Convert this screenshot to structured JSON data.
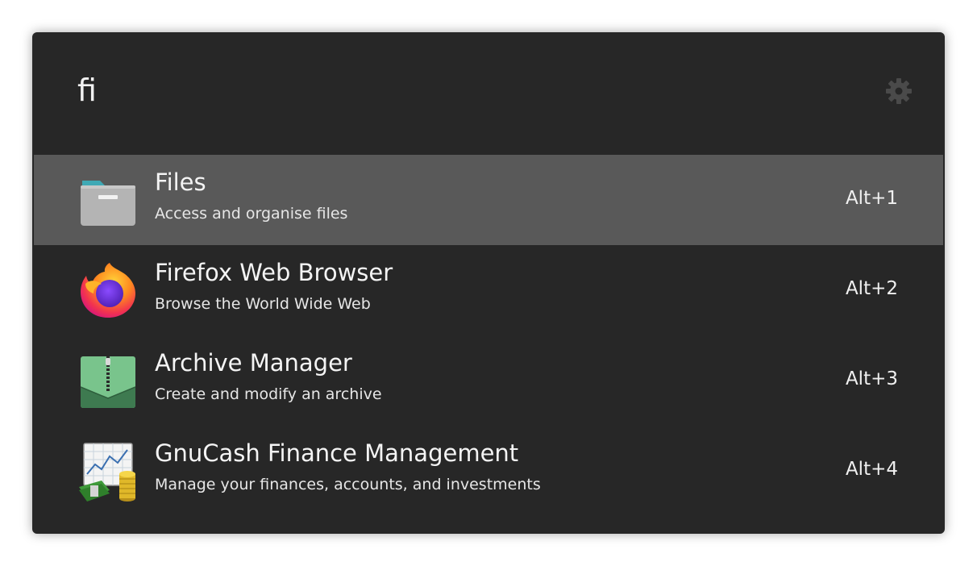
{
  "search": {
    "value": "fi"
  },
  "settings": {
    "icon": "gear-icon"
  },
  "colors": {
    "window_bg": "#272727",
    "selected_bg": "#595959",
    "text": "#f4f4f4"
  },
  "results": [
    {
      "title": "Files",
      "description": "Access and organise files",
      "shortcut": "Alt+1",
      "icon": "folder-icon",
      "selected": true
    },
    {
      "title": "Firefox Web Browser",
      "description": "Browse the World Wide Web",
      "shortcut": "Alt+2",
      "icon": "firefox-icon",
      "selected": false
    },
    {
      "title": "Archive Manager",
      "description": "Create and modify an archive",
      "shortcut": "Alt+3",
      "icon": "archive-icon",
      "selected": false
    },
    {
      "title": "GnuCash Finance Management",
      "description": "Manage your finances, accounts, and investments",
      "shortcut": "Alt+4",
      "icon": "gnucash-icon",
      "selected": false
    }
  ]
}
